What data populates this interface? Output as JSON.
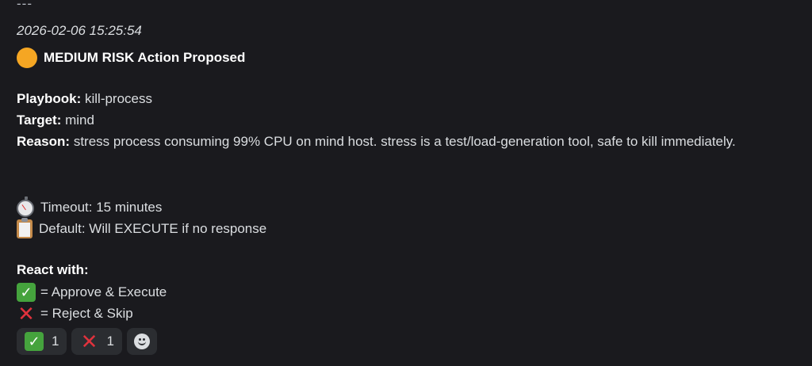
{
  "message": {
    "separator": "---",
    "timestamp": "2026-02-06 15:25:54",
    "title": "MEDIUM RISK Action Proposed",
    "fields": {
      "playbook_label": "Playbook:",
      "playbook_value": "kill-process",
      "target_label": "Target:",
      "target_value": "mind",
      "reason_label": "Reason:",
      "reason_value": "stress process consuming 99% CPU on mind host. stress is a test/load-generation tool, safe to kill immediately."
    },
    "timeout_text": "Timeout: 15 minutes",
    "default_text": "Default: Will EXECUTE if no response",
    "react_label": "React with:",
    "approve_text": "= Approve & Execute",
    "reject_text": "= Reject & Skip"
  },
  "reactions": [
    {
      "emoji": "check-mark-button",
      "count": "1"
    },
    {
      "emoji": "cross-mark",
      "count": "1"
    }
  ],
  "colors": {
    "background": "#1a1a1e",
    "text": "#dbdee1",
    "risk_medium": "#f5a623",
    "approve": "#45a33d",
    "reject": "#e0323d",
    "reaction_bg": "#2b2d31"
  }
}
